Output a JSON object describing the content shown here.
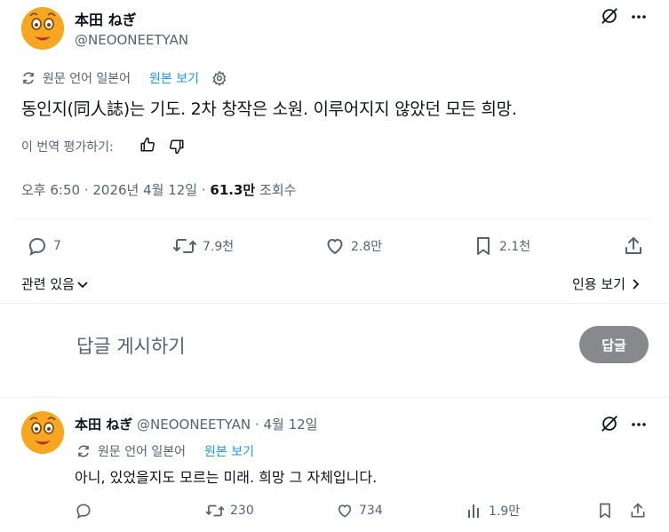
{
  "main_tweet": {
    "display_name": "本田 ねぎ",
    "handle": "@NEOONEETYAN",
    "translation_note": "원문 언어 일본어",
    "view_original": "원본 보기",
    "body": "동인지(同人誌)는 기도. 2차 창작은 소원. 이루어지지 않았던 모든 희망.",
    "rate_translation": "이 번역 평가하기:",
    "time": "오후 6:50 · 2026년 4월 12일 ·",
    "views_count": "61.3만",
    "views_label": "조회수",
    "stats": {
      "replies": "7",
      "retweets": "7.9천",
      "likes": "2.8만",
      "bookmarks": "2.1천"
    },
    "related": "관련 있음",
    "quotes": "인용 보기"
  },
  "composer": {
    "placeholder": "답글 게시하기",
    "button": "답글"
  },
  "reply_tweet": {
    "display_name": "本田 ねぎ",
    "handle": "@NEOONEETYAN",
    "date": "· 4월 12일",
    "translation_note": "원문 언어 일본어",
    "view_original": "원본 보기",
    "body": "아니, 있었을지도 모르는 미래. 희망 그 자체입니다.",
    "stats": {
      "retweets": "230",
      "likes": "734",
      "views": "1.9만"
    }
  },
  "colors": {
    "accent": "#1d9bf0",
    "muted": "#536471",
    "avatar": "#f7a621",
    "reply_button": "#87898c"
  }
}
